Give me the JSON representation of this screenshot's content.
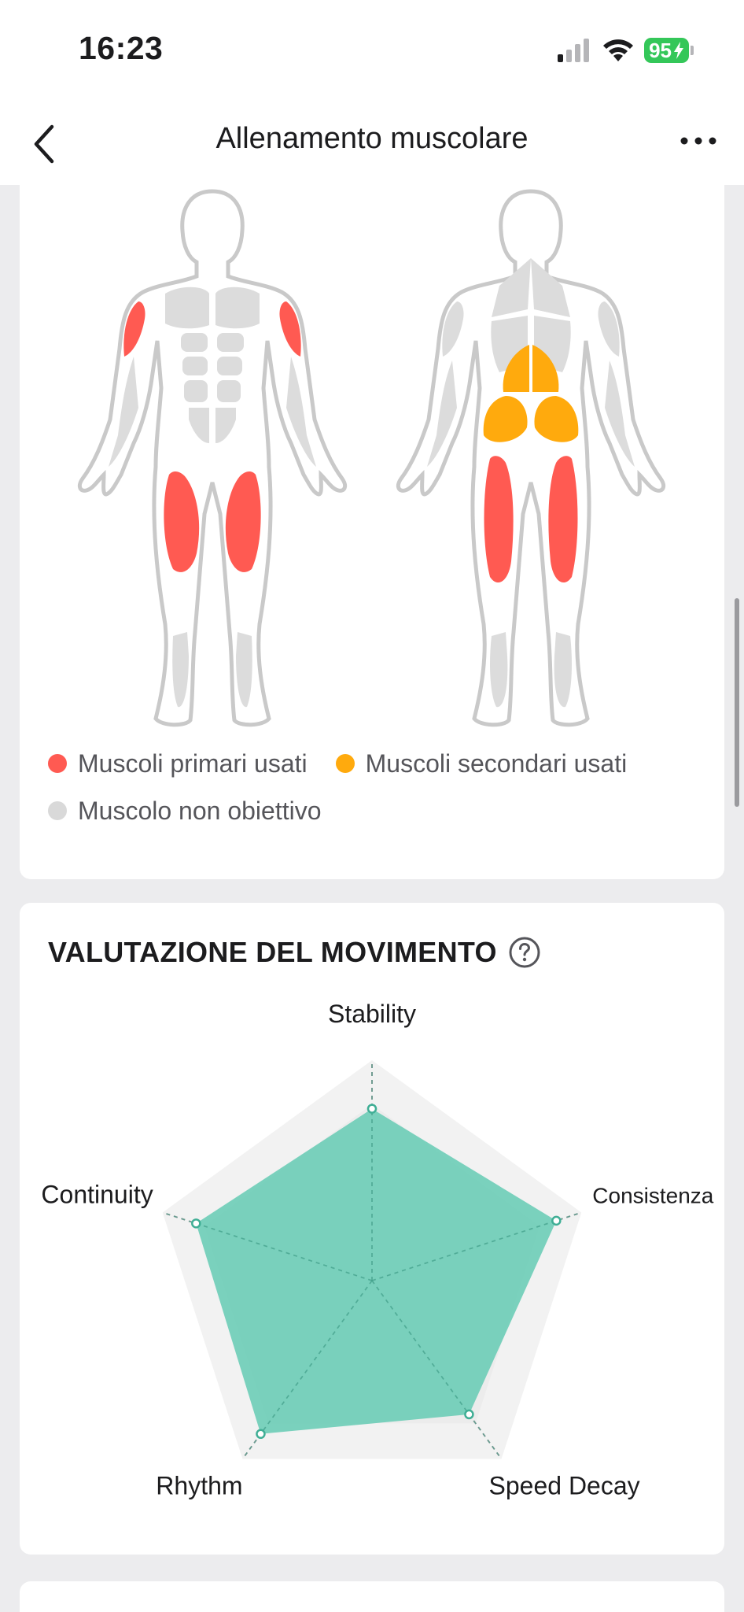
{
  "status_bar": {
    "time": "16:23",
    "battery": "95",
    "icons": [
      "signal-icon",
      "wifi-icon",
      "battery-icon"
    ]
  },
  "nav": {
    "title": "Allenamento muscolare",
    "back_icon": "chevron-left-icon",
    "more_icon": "more-horizontal-icon"
  },
  "muscles": {
    "legend": [
      {
        "label": "Muscoli primari usati",
        "color": "#ff5a52"
      },
      {
        "label": "Muscoli secondari usati",
        "color": "#ffaa0d"
      },
      {
        "label": "Muscolo non obiettivo",
        "color": "#d9d9d9"
      }
    ]
  },
  "evaluation": {
    "title": "VALUTAZIONE DEL MOVIMENTO",
    "help_icon": "question-circle-icon",
    "radar_data": {
      "type": "radar",
      "axes": [
        "Stability",
        "Consistenza",
        "Speed Decay",
        "Rhythm",
        "Continuity"
      ],
      "values": [
        0.78,
        0.88,
        0.75,
        0.86,
        0.84
      ],
      "range": [
        0,
        1
      ],
      "fill_color": "#5fc9b1"
    }
  }
}
